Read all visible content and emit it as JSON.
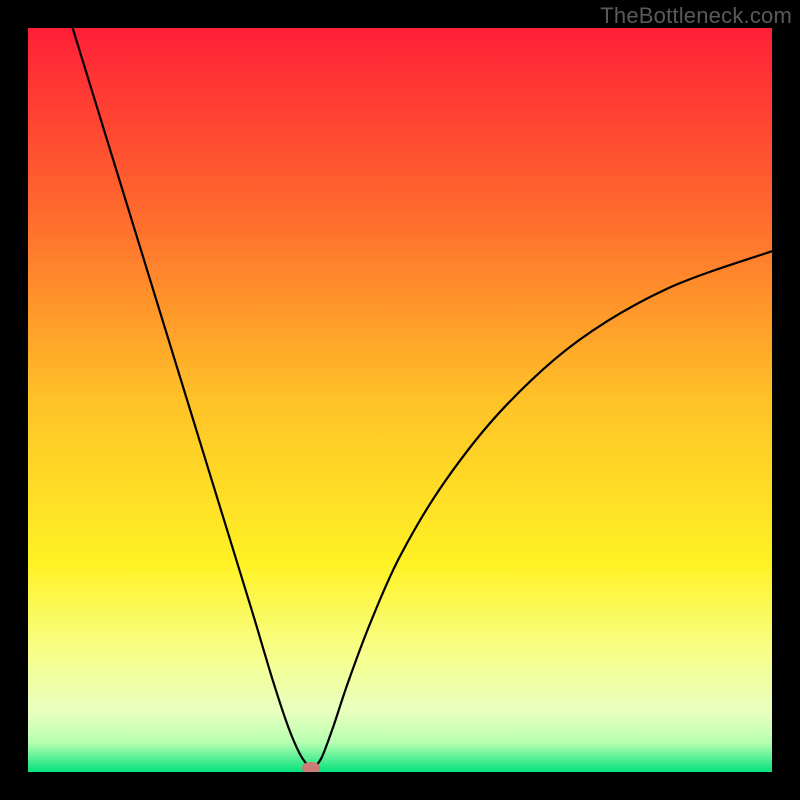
{
  "watermark": "TheBottleneck.com",
  "chart_data": {
    "type": "line",
    "title": "",
    "xlabel": "",
    "ylabel": "",
    "xlim": [
      0,
      100
    ],
    "ylim": [
      0,
      100
    ],
    "series": [
      {
        "name": "left-branch",
        "x": [
          6,
          10,
          14,
          18,
          22,
          26,
          30,
          33,
          35,
          36.5,
          37.5,
          38
        ],
        "y": [
          100,
          87,
          74,
          61,
          48,
          35,
          22,
          12,
          6,
          2.5,
          1,
          0.6
        ]
      },
      {
        "name": "right-branch",
        "x": [
          38.5,
          39.5,
          41,
          43,
          46,
          50,
          56,
          64,
          74,
          86,
          100
        ],
        "y": [
          0.6,
          2,
          6,
          12,
          20,
          29,
          39,
          49,
          58,
          65,
          70
        ]
      }
    ],
    "marker": {
      "x": 38,
      "y": 0.6
    },
    "gradient_stops": [
      {
        "offset": 0.0,
        "color": "#ff1f37"
      },
      {
        "offset": 0.25,
        "color": "#ff6a2d"
      },
      {
        "offset": 0.5,
        "color": "#ffc228"
      },
      {
        "offset": 0.72,
        "color": "#fff224"
      },
      {
        "offset": 0.84,
        "color": "#f7ff8a"
      },
      {
        "offset": 0.92,
        "color": "#e8ffc0"
      },
      {
        "offset": 0.96,
        "color": "#b7ffb0"
      },
      {
        "offset": 1.0,
        "color": "#06e27d"
      }
    ]
  }
}
